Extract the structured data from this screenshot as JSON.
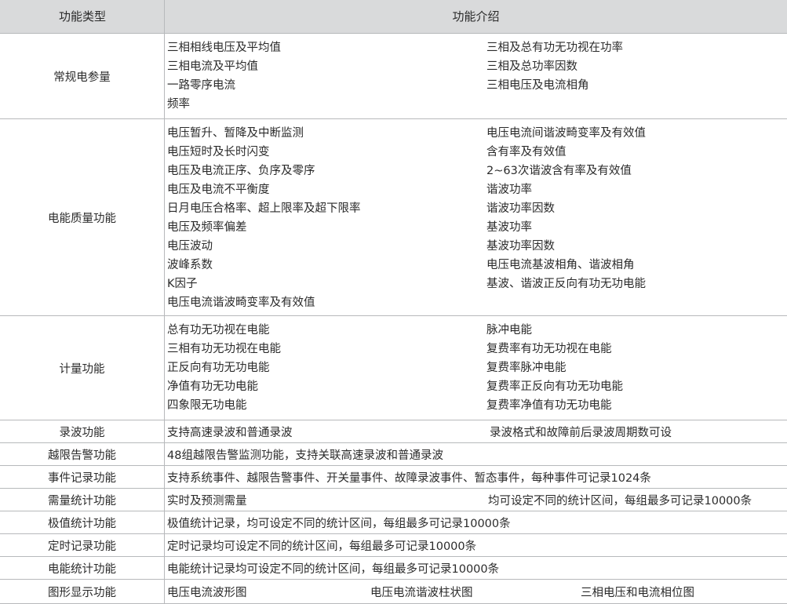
{
  "header": {
    "col1": "功能类型",
    "col2": "功能介绍"
  },
  "rows": [
    {
      "type": "常规电参量",
      "left": [
        "三相相线电压及平均值",
        "三相电流及平均值",
        "一路零序电流",
        "频率"
      ],
      "right": [
        "三相及总有功无功视在功率",
        "三相及总功率因数",
        "三相电压及电流相角"
      ]
    },
    {
      "type": "电能质量功能",
      "left": [
        "电压暂升、暂降及中断监测",
        "电压短时及长时闪变",
        "电压及电流正序、负序及零序",
        "电压及电流不平衡度",
        "日月电压合格率、超上限率及超下限率",
        "电压及频率偏差",
        "电压波动",
        "波峰系数",
        "K因子",
        "电压电流谐波畸变率及有效值"
      ],
      "right": [
        "电压电流间谐波畸变率及有效值",
        "含有率及有效值",
        "2~63次谐波含有率及有效值",
        "谐波功率",
        "谐波功率因数",
        "基波功率",
        "基波功率因数",
        "电压电流基波相角、谐波相角",
        "基波、谐波正反向有功无功电能"
      ]
    },
    {
      "type": "计量功能",
      "left": [
        "总有功无功视在电能",
        "三相有功无功视在电能",
        "正反向有功无功电能",
        "净值有功无功电能",
        "四象限无功电能"
      ],
      "right": [
        "脉冲电能",
        "复费率有功无功视在电能",
        "复费率脉冲电能",
        "复费率正反向有功无功电能",
        "复费率净值有功无功电能"
      ]
    },
    {
      "type": "录波功能",
      "left": "支持高速录波和普通录波",
      "right": "录波格式和故障前后录波周期数可设"
    },
    {
      "type": "越限告警功能",
      "left": "48组越限告警监测功能，支持关联高速录波和普通录波"
    },
    {
      "type": "事件记录功能",
      "left": "支持系统事件、越限告警事件、开关量事件、故障录波事件、暂态事件，每种事件可记录1024条"
    },
    {
      "type": "需量统计功能",
      "left": "实时及预测需量",
      "right": "均可设定不同的统计区间，每组最多可记录10000条"
    },
    {
      "type": "极值统计功能",
      "left": "极值统计记录，均可设定不同的统计区间，每组最多可记录10000条"
    },
    {
      "type": "定时记录功能",
      "left": "定时记录均可设定不同的统计区间，每组最多可记录10000条"
    },
    {
      "type": "电能统计功能",
      "left": "电能统计记录均可设定不同的统计区间，每组最多可记录10000条"
    },
    {
      "type": "图形显示功能",
      "left": "电压电流波形图",
      "mid": "电压电流谐波柱状图",
      "right": "三相电压和电流相位图"
    }
  ]
}
